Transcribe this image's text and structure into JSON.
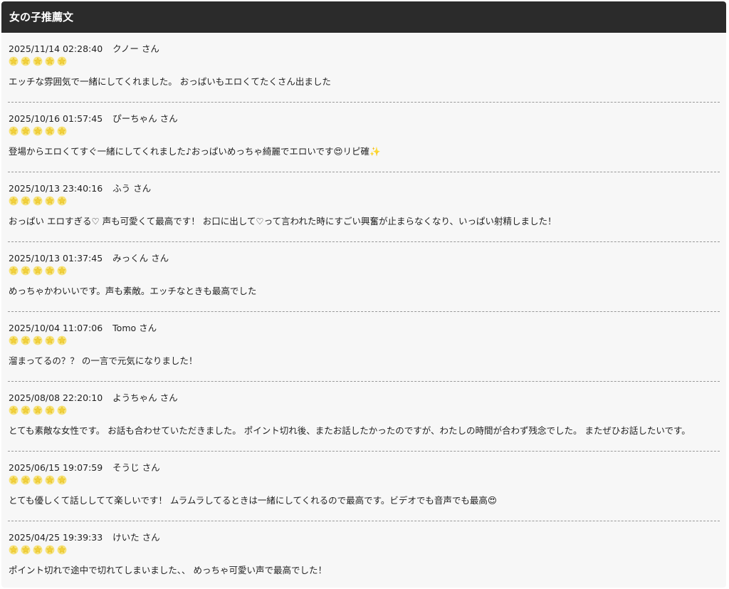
{
  "header": {
    "title": "女の子推薦文"
  },
  "colors": {
    "header_bg": "#2b2b2b",
    "star": "#f2d13b",
    "divider": "#999999"
  },
  "reviews": [
    {
      "date": "2025/11/14 02:28:40",
      "user": "クノー さん",
      "rating": 5,
      "comment": "エッチな雰囲気で一緒にしてくれました。 おっぱいもエロくてたくさん出ました"
    },
    {
      "date": "2025/10/16 01:57:45",
      "user": "ぴーちゃん さん",
      "rating": 5,
      "comment": "登場からエロくてすぐ一緒にしてくれました♪おっぱいめっちゃ綺麗でエロいです😍リピ確✨"
    },
    {
      "date": "2025/10/13 23:40:16",
      "user": "ふう さん",
      "rating": 5,
      "comment": "おっぱい エロすぎる♡ 声も可愛くて最高です！ お口に出して♡って言われた時にすごい興奮が止まらなくなり、いっぱい射精しました！"
    },
    {
      "date": "2025/10/13 01:37:45",
      "user": "みっくん さん",
      "rating": 5,
      "comment": "めっちゃかわいいです。声も素敵。エッチなときも最高でした"
    },
    {
      "date": "2025/10/04 11:07:06",
      "user": "Tomo さん",
      "rating": 5,
      "comment": "溜まってるの？？ の一言で元気になりました！"
    },
    {
      "date": "2025/08/08 22:20:10",
      "user": "ようちゃん さん",
      "rating": 5,
      "comment": "とても素敵な女性です。 お話も合わせていただきました。 ポイント切れ後、またお話したかったのですが、わたしの時間が合わず残念でした。 またぜひお話したいです。"
    },
    {
      "date": "2025/06/15 19:07:59",
      "user": "そうじ さん",
      "rating": 5,
      "comment": "とても優しくて話ししてて楽しいです！ ムラムラしてるときは一緒にしてくれるので最高です。ビデオでも音声でも最高😍"
    },
    {
      "date": "2025/04/25 19:39:33",
      "user": "けいた さん",
      "rating": 5,
      "comment": "ポイント切れで途中で切れてしまいました、、 めっちゃ可愛い声で最高でした！"
    }
  ]
}
